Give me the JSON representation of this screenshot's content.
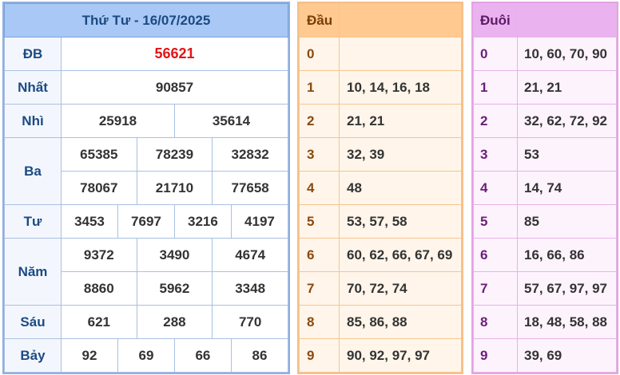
{
  "header": {
    "title": "Thứ Tư - 16/07/2025"
  },
  "prizes": [
    {
      "label": "ĐB",
      "numbers": [
        "56621"
      ]
    },
    {
      "label": "Nhất",
      "numbers": [
        "90857"
      ]
    },
    {
      "label": "Nhì",
      "numbers": [
        "25918",
        "35614"
      ]
    },
    {
      "label": "Ba",
      "numbers": [
        "65385",
        "78239",
        "32832",
        "78067",
        "21710",
        "77658"
      ]
    },
    {
      "label": "Tư",
      "numbers": [
        "3453",
        "7697",
        "3216",
        "4197"
      ]
    },
    {
      "label": "Năm",
      "numbers": [
        "9372",
        "3490",
        "4674",
        "8860",
        "5962",
        "3348"
      ]
    },
    {
      "label": "Sáu",
      "numbers": [
        "621",
        "288",
        "770"
      ]
    },
    {
      "label": "Bảy",
      "numbers": [
        "92",
        "69",
        "66",
        "86"
      ]
    }
  ],
  "dau": {
    "title": "Đầu",
    "rows": [
      {
        "num": "0",
        "values": ""
      },
      {
        "num": "1",
        "values": "10, 14, 16, 18"
      },
      {
        "num": "2",
        "values": "21, 21"
      },
      {
        "num": "3",
        "values": "32, 39"
      },
      {
        "num": "4",
        "values": "48"
      },
      {
        "num": "5",
        "values": "53, 57, 58"
      },
      {
        "num": "6",
        "values": "60, 62, 66, 67, 69"
      },
      {
        "num": "7",
        "values": "70, 72, 74"
      },
      {
        "num": "8",
        "values": "85, 86, 88"
      },
      {
        "num": "9",
        "values": "90, 92, 97, 97"
      }
    ]
  },
  "duoi": {
    "title": "Đuôi",
    "rows": [
      {
        "num": "0",
        "values": "10, 60, 70, 90"
      },
      {
        "num": "1",
        "values": "21, 21"
      },
      {
        "num": "2",
        "values": "32, 62, 72, 92"
      },
      {
        "num": "3",
        "values": "53"
      },
      {
        "num": "4",
        "values": "14, 74"
      },
      {
        "num": "5",
        "values": "85"
      },
      {
        "num": "6",
        "values": "16, 66, 86"
      },
      {
        "num": "7",
        "values": "57, 67, 97, 97"
      },
      {
        "num": "8",
        "values": "18, 48, 58, 88"
      },
      {
        "num": "9",
        "values": "39, 69"
      }
    ]
  },
  "colors": {
    "special_prize": "#e31414",
    "result_header": "#a9c8f5",
    "dau_header": "#ffc98f",
    "duoi_header": "#eab2ee"
  }
}
